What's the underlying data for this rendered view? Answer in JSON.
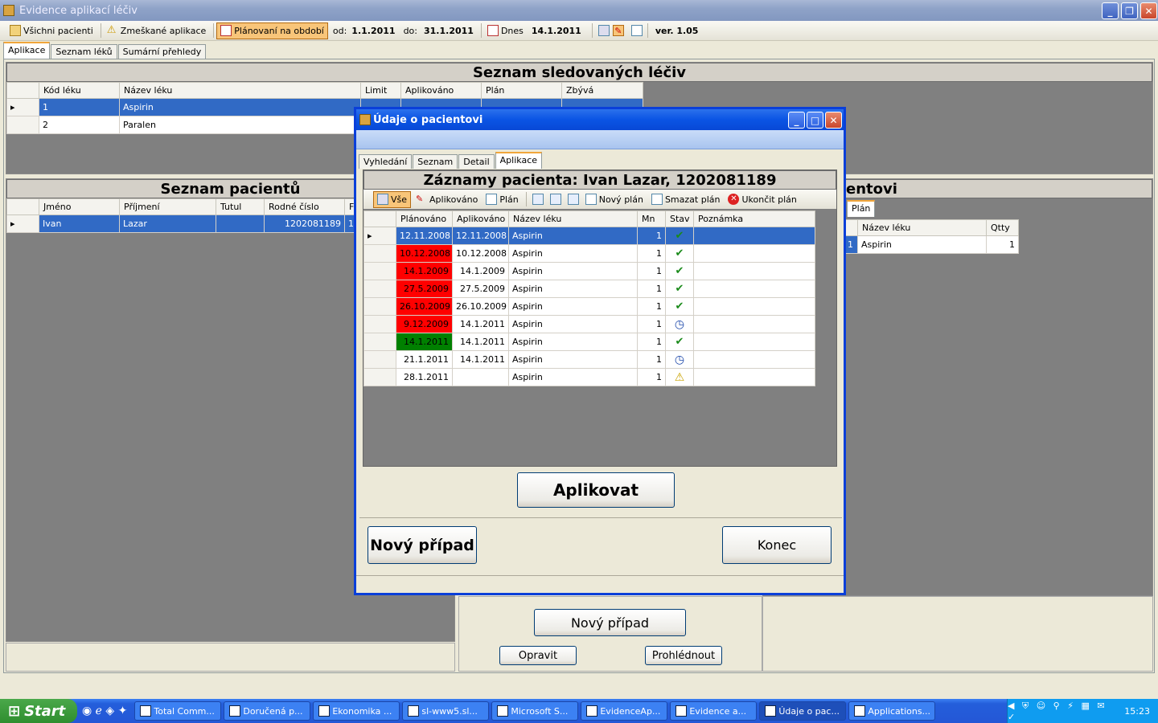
{
  "window": {
    "title": "Evidence aplikací léčiv"
  },
  "toolbar": {
    "all_patients": "Všichni pacienti",
    "missed": "Zmeškané aplikace",
    "planning": "Plánovaní na období",
    "from_label": "od:",
    "from": "1.1.2011",
    "to_label": "do:",
    "to": "31.1.2011",
    "today_label": "Dnes",
    "today": "14.1.2011",
    "version": "ver. 1.05"
  },
  "main_tabs": [
    "Aplikace",
    "Seznam léků",
    "Sumární přehledy"
  ],
  "drugs": {
    "title": "Seznam sledovaných léčiv",
    "columns": [
      "Kód léku",
      "Název léku",
      "Limit",
      "Aplikováno",
      "Plán",
      "Zbývá"
    ],
    "rows": [
      [
        "1",
        "Aspirin",
        "",
        "",
        "",
        ""
      ],
      [
        "2",
        "Paralen",
        "",
        "",
        "",
        ""
      ]
    ]
  },
  "patients": {
    "title": "Seznam pacientů",
    "columns": [
      "Jméno",
      "Příjmení",
      "Tutul",
      "Rodné číslo",
      "F"
    ],
    "rows": [
      [
        "Ivan",
        "Lazar",
        "",
        "1202081189",
        "1"
      ]
    ]
  },
  "right_panel": {
    "title": "entovi",
    "tab": "Plán",
    "columns": [
      "Název léku",
      "Qtty"
    ],
    "rows": [
      [
        "1",
        "Aspirin",
        "1"
      ]
    ]
  },
  "bottom_buttons": {
    "new_case": "Nový případ",
    "edit": "Opravit",
    "view": "Prohlédnout"
  },
  "dialog": {
    "title": "Údaje o pacientovi",
    "tabs": [
      "Vyhledání",
      "Seznam",
      "Detail",
      "Aplikace"
    ],
    "header": "Záznamy pacienta: Ivan Lazar, 1202081189",
    "toolbar": {
      "all": "Vše",
      "applied": "Aplikováno",
      "plan": "Plán",
      "new_plan": "Nový plán",
      "delete_plan": "Smazat plán",
      "end_plan": "Ukončit plán"
    },
    "columns": [
      "Plánováno",
      "Aplikováno",
      "Název léku",
      "Mn",
      "Stav",
      "Poznámka"
    ],
    "rows": [
      {
        "planned": "12.11.2008",
        "applied": "12.11.2008",
        "drug": "Aspirin",
        "qty": "1",
        "status": "check",
        "color": "sel"
      },
      {
        "planned": "10.12.2008",
        "applied": "10.12.2008",
        "drug": "Aspirin",
        "qty": "1",
        "status": "check",
        "color": "#ff0000"
      },
      {
        "planned": "14.1.2009",
        "applied": "14.1.2009",
        "drug": "Aspirin",
        "qty": "1",
        "status": "check",
        "color": "#ff0000"
      },
      {
        "planned": "27.5.2009",
        "applied": "27.5.2009",
        "drug": "Aspirin",
        "qty": "1",
        "status": "check",
        "color": "#ff0000"
      },
      {
        "planned": "26.10.2009",
        "applied": "26.10.2009",
        "drug": "Aspirin",
        "qty": "1",
        "status": "check",
        "color": "#ff0000"
      },
      {
        "planned": "9.12.2009",
        "applied": "14.1.2011",
        "drug": "Aspirin",
        "qty": "1",
        "status": "clock",
        "color": "#ff0000"
      },
      {
        "planned": "14.1.2011",
        "applied": "14.1.2011",
        "drug": "Aspirin",
        "qty": "1",
        "status": "check",
        "color": "#008000"
      },
      {
        "planned": "21.1.2011",
        "applied": "14.1.2011",
        "drug": "Aspirin",
        "qty": "1",
        "status": "clock",
        "color": "#ffffff"
      },
      {
        "planned": "28.1.2011",
        "applied": "",
        "drug": "Aspirin",
        "qty": "1",
        "status": "warning",
        "color": "#ffffff"
      }
    ],
    "apply_button": "Aplikovat",
    "new_case_button": "Nový případ",
    "end_button": "Konec"
  },
  "taskbar": {
    "start": "Start",
    "items": [
      "Total Comm...",
      "Doručená p...",
      "Ekonomika ...",
      "sl-www5.sl...",
      "Microsoft S...",
      "EvidenceAp...",
      "Evidence a...",
      "Údaje o pac...",
      "Applications..."
    ],
    "clock": "15:23"
  }
}
